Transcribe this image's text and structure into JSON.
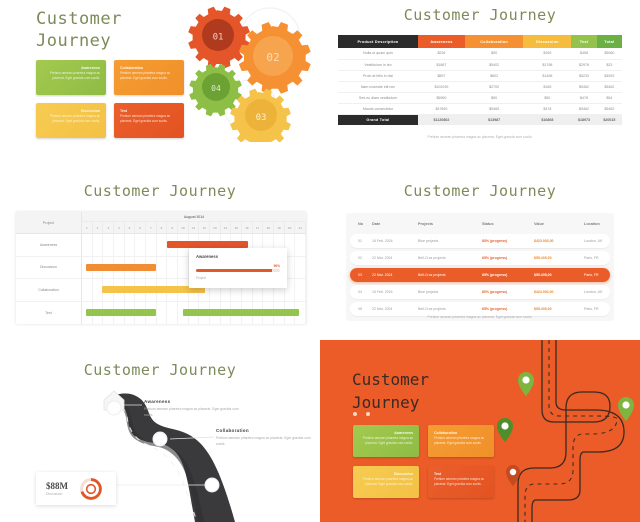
{
  "common": {
    "title": "Customer Journey",
    "title_line1": "Customer",
    "title_line2": "Journey",
    "caption": "Pretium aenean pharetra magna ac placerat. Eget gravida cum sociis.",
    "body_text": "Pretium aenean pharetra magna ac placerat. Eget gravida cum sociis.",
    "colors": {
      "green": "#a3c94f",
      "orange": "#f59c32",
      "yellow": "#f7cb52",
      "red": "#ea5f2b",
      "dark": "#2b2b2b",
      "title_green": "#7d8a5a"
    }
  },
  "slide1": {
    "cards": [
      {
        "label": "Awareness",
        "text": "Pretium aenean pharetra magna ac placerat. Eget gravida cum sociis.",
        "color": "green",
        "align": "right"
      },
      {
        "label": "Collaboration",
        "text": "Pretium aenean pharetra magna ac placerat. Eget gravida cum sociis.",
        "color": "orange",
        "align": "left"
      },
      {
        "label": "Discussion",
        "text": "Pretium aenean pharetra magna ac placerat. Eget gravida cum sociis.",
        "color": "yellow",
        "align": "right"
      },
      {
        "label": "Test",
        "text": "Pretium aenean pharetra magna ac placerat. Eget gravida cum sociis.",
        "color": "red",
        "align": "left"
      }
    ],
    "gears": [
      {
        "number": "01",
        "color": "#e4552a",
        "inner": "#b03a1d"
      },
      {
        "number": "02",
        "color": "#f59133",
        "inner": "#f7a44f"
      },
      {
        "number": "03",
        "color": "#f5c24a",
        "inner": "#edb23a"
      },
      {
        "number": "04",
        "color": "#8dbe46",
        "inner": "#6ca233"
      }
    ]
  },
  "slide2": {
    "headers": [
      "Product  Description",
      "Awareness",
      "Collaboration",
      "Discussion",
      "Test",
      "Total"
    ],
    "rows": [
      [
        "Nulla ut quam quis",
        "$226",
        "$50",
        "$169",
        "$458",
        "$5080"
      ],
      [
        "Vestibulum in leo",
        "$1867",
        "$5402",
        "$1798",
        "$2978",
        "$23"
      ],
      [
        "Proin at felis in nisi",
        "$897",
        "$802",
        "$1458",
        "$5233",
        "$4592"
      ],
      [
        "Nam molestie elit nec",
        "$102039",
        "$2700",
        "$165",
        "$5462",
        "$5462"
      ],
      [
        "Sed eu diam vestibulum",
        "$5960",
        "$50",
        "$50",
        "$478",
        "$54"
      ],
      [
        "Mauris consectetur",
        "$47890",
        "$5465",
        "$478",
        "$5462",
        "$5462"
      ]
    ],
    "footer": [
      "Grand Total",
      "$1120802",
      "$13987",
      "$16808",
      "$18973",
      "$20615"
    ],
    "caption": "Pretium aenean pharetra magna ac placerat. Eget gravida cum sociis."
  },
  "slide3": {
    "project_header": "Project",
    "month": "August 2014",
    "days": [
      "1",
      "2",
      "3",
      "4",
      "5",
      "6",
      "7",
      "8",
      "9",
      "10",
      "11",
      "12",
      "13",
      "14",
      "15",
      "16",
      "17",
      "18",
      "19",
      "20",
      "21"
    ],
    "rows": [
      {
        "label": "Awareness",
        "bars": [
          {
            "start": 38,
            "width": 36,
            "color": "#e4552a"
          }
        ]
      },
      {
        "label": "Discussion",
        "bars": [
          {
            "start": 2,
            "width": 31,
            "color": "#f18e33"
          }
        ]
      },
      {
        "label": "Collaboration",
        "bars": [
          {
            "start": 9,
            "width": 46,
            "color": "#f5c24a"
          }
        ]
      },
      {
        "label": "Test",
        "bars": [
          {
            "start": 2,
            "width": 31,
            "color": "#93c44c"
          },
          {
            "start": 45,
            "width": 52,
            "color": "#93c44c"
          }
        ]
      }
    ],
    "tooltip": {
      "title": "Awareness",
      "percent": "90%",
      "progress": 90,
      "subtitle": "Project"
    }
  },
  "slide4": {
    "headers": [
      "No",
      "Date",
      "Projects",
      "Status",
      "Value",
      "Location"
    ],
    "rows": [
      {
        "no": "01",
        "date": "16 Feb. 2024",
        "project": "Blue projects",
        "status": "80% (progress)",
        "value": "$423.903,00",
        "location": "London, UK",
        "active": false
      },
      {
        "no": "02",
        "date": "22 Mar. 2024",
        "project": "Bell-Croz projects",
        "status": "65% (progress)",
        "value": "$55.405,00",
        "location": "Paris, FR",
        "active": false
      },
      {
        "no": "03",
        "date": "22 Mar. 2024",
        "project": "Bell-Croz projects",
        "status": "65% (progress)",
        "value": "$55.405,00",
        "location": "Paris, FR",
        "active": true
      },
      {
        "no": "04",
        "date": "16 Feb. 2024",
        "project": "Blue projects",
        "status": "80% (progress)",
        "value": "$423.903,00",
        "location": "London, UK",
        "active": false
      },
      {
        "no": "05",
        "date": "22 Mar. 2024",
        "project": "Bell-Croz projects",
        "status": "65% (progress)",
        "value": "$55.405,00",
        "location": "Paris, FR",
        "active": false
      }
    ],
    "caption": "Pretium aenean pharetra magna ac placerat. Eget gravida cum sociis."
  },
  "slide5": {
    "milestones": [
      {
        "label": "Awareness",
        "text": "Pretium aenean pharetra magna ac placerat. Eget gravida cum sociis."
      },
      {
        "label": "Collaboration",
        "text": "Pretium aenean pharetra magna ac placerat. Eget gravida cum sociis."
      }
    ],
    "stat": {
      "value": "$88M",
      "label": "Discussion",
      "percent": 70
    }
  },
  "slide6": {
    "cards": [
      {
        "label": "Awareness",
        "text": "Pretium aenean pharetra magna ac placerat. Eget gravida cum sociis.",
        "color": "green",
        "align": "right"
      },
      {
        "label": "Collaboration",
        "text": "Pretium aenean pharetra magna ac placerat. Eget gravida cum sociis.",
        "color": "orange",
        "align": "left"
      },
      {
        "label": "Discussion",
        "text": "Pretium aenean pharetra magna ac placerat. Eget gravida cum sociis.",
        "color": "yellow",
        "align": "right"
      },
      {
        "label": "Test",
        "text": "Pretium aenean pharetra magna ac placerat. Eget gravida cum sociis.",
        "color": "red",
        "align": "left"
      }
    ],
    "pins": 4
  }
}
